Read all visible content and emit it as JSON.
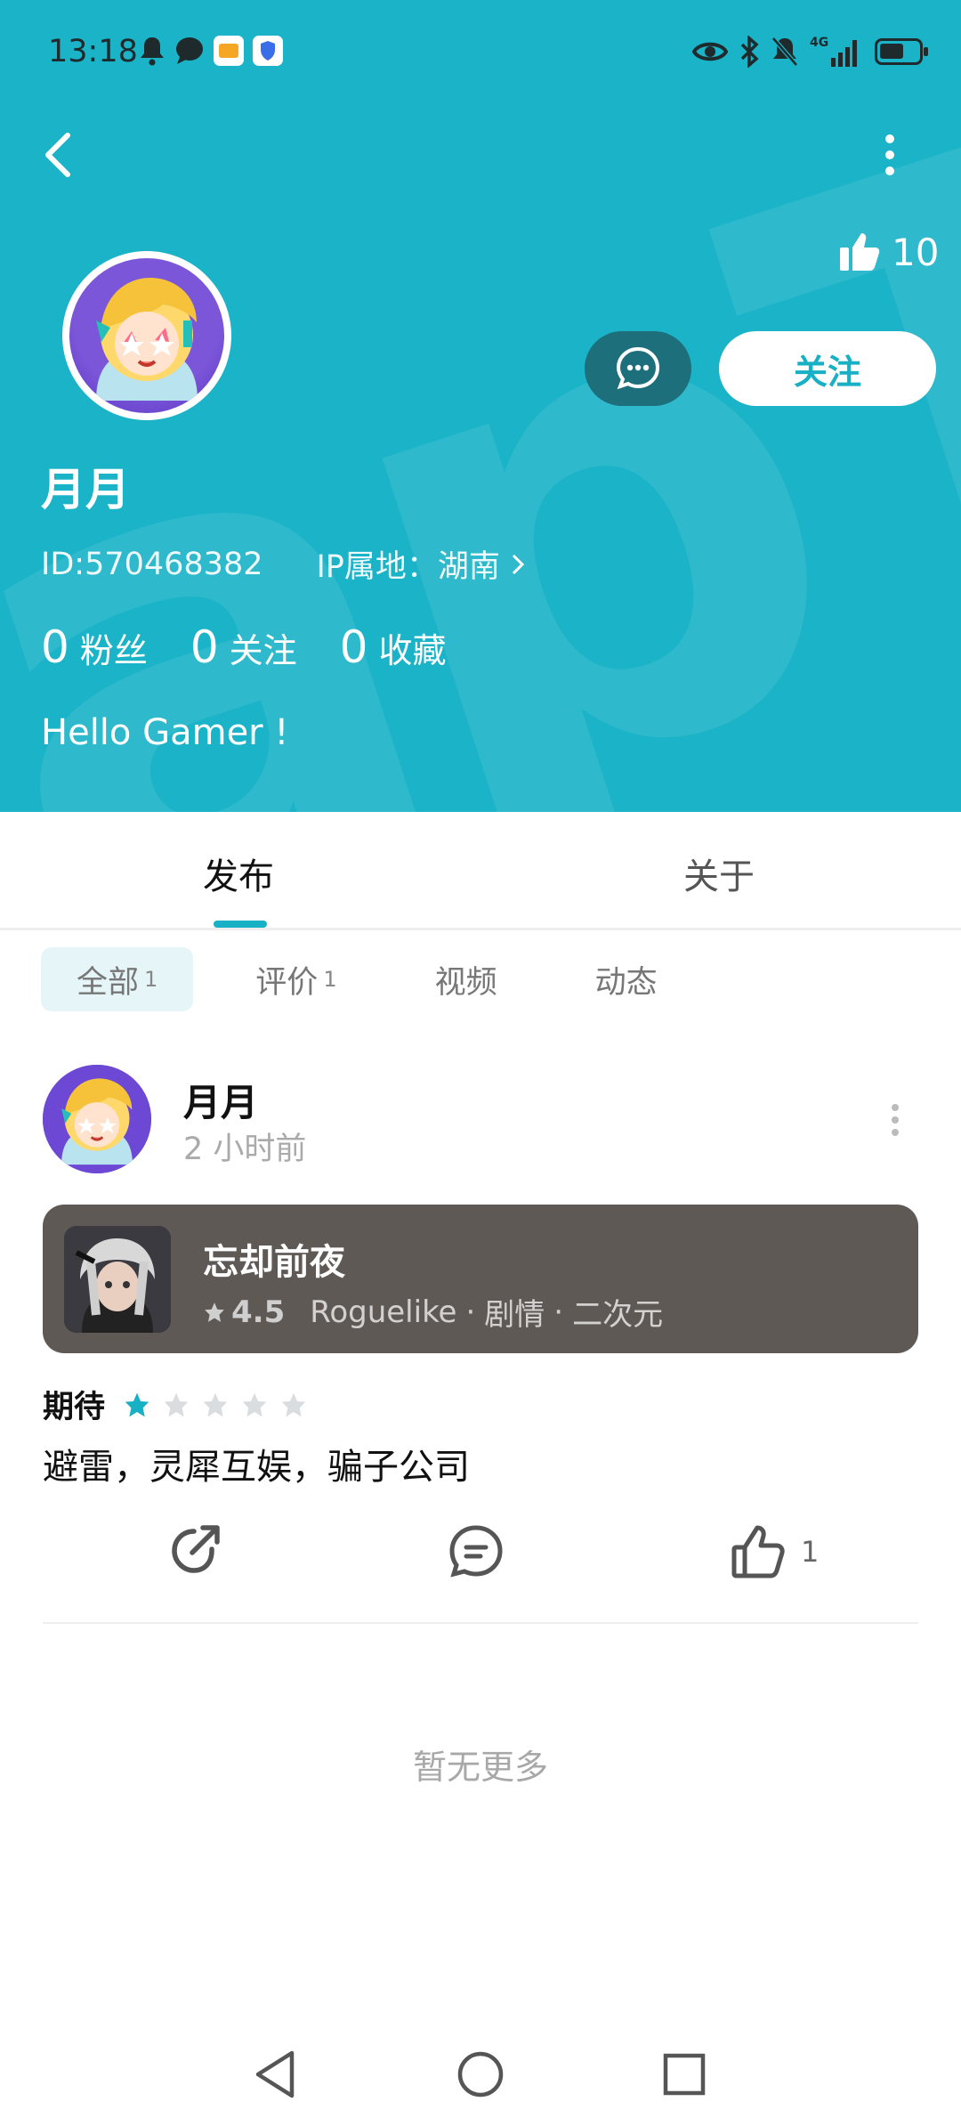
{
  "status_bar": {
    "time": "13:18",
    "left_icons": [
      "bell-icon",
      "chat-bubble-icon",
      "app-badge-icon",
      "shield-icon"
    ],
    "right_icons": [
      "eye-icon",
      "bluetooth-icon",
      "mute-bell-icon",
      "signal-4g-icon",
      "battery-icon"
    ],
    "network_label": "4G"
  },
  "header": {
    "like_count": "10",
    "follow_label": "关注",
    "name": "月月",
    "id_text": "ID:570468382",
    "ip_text": "IP属地：湖南",
    "bio": "Hello Gamer !",
    "accent_color": "#1ab3c8"
  },
  "stats": [
    {
      "num": "0",
      "label": "粉丝"
    },
    {
      "num": "0",
      "label": "关注"
    },
    {
      "num": "0",
      "label": "收藏"
    }
  ],
  "tabs": [
    {
      "label": "发布",
      "active": true
    },
    {
      "label": "关于",
      "active": false
    }
  ],
  "filters": [
    {
      "label": "全部",
      "count": "1",
      "active": true
    },
    {
      "label": "评价",
      "count": "1",
      "active": false
    },
    {
      "label": "视频",
      "count": "",
      "active": false
    },
    {
      "label": "动态",
      "count": "",
      "active": false
    }
  ],
  "post": {
    "author": "月月",
    "time": "2 小时前",
    "game": {
      "title": "忘却前夜",
      "rating": "4.5",
      "tags": [
        "Roguelike",
        "剧情",
        "二次元"
      ],
      "separator": "·"
    },
    "expect_label": "期待",
    "stars": 1,
    "stars_total": 5,
    "text": "避雷，灵犀互娱，骗子公司",
    "like_count": "1"
  },
  "footer_text": "暂无更多"
}
